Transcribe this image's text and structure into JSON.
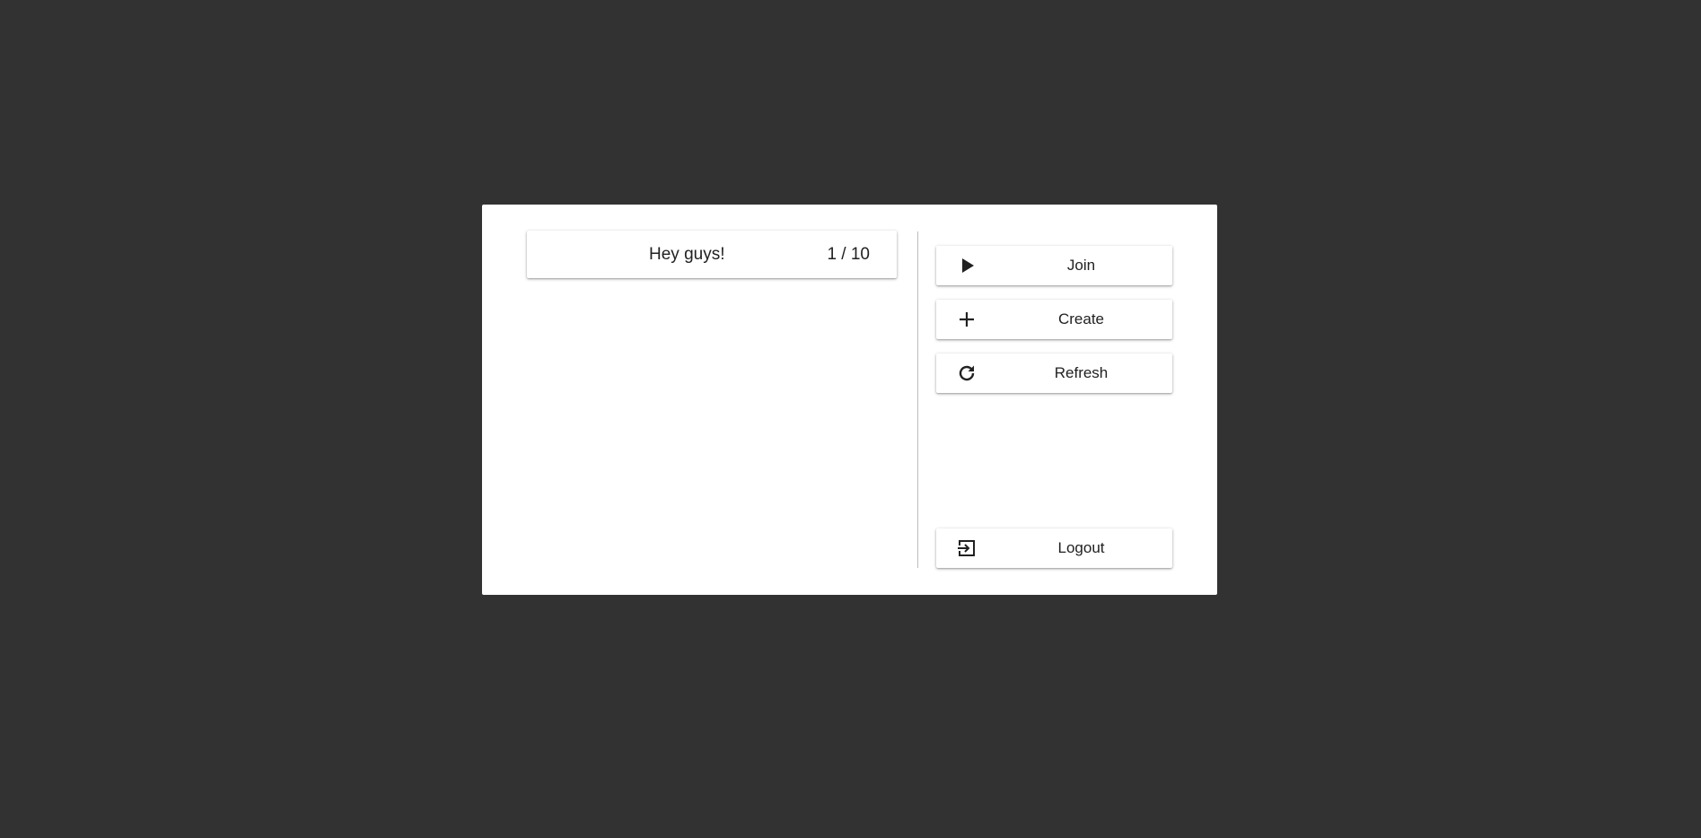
{
  "rooms": [
    {
      "name": "Hey guys!",
      "count": "1 / 10"
    }
  ],
  "actions": {
    "join_label": "Join",
    "create_label": "Create",
    "refresh_label": "Refresh",
    "logout_label": "Logout"
  },
  "icons": {
    "join": "play-icon",
    "create": "plus-icon",
    "refresh": "refresh-icon",
    "logout": "logout-icon"
  },
  "colors": {
    "background": "#323232",
    "panel": "#ffffff",
    "text": "#212121",
    "divider": "#bdbdbd"
  }
}
